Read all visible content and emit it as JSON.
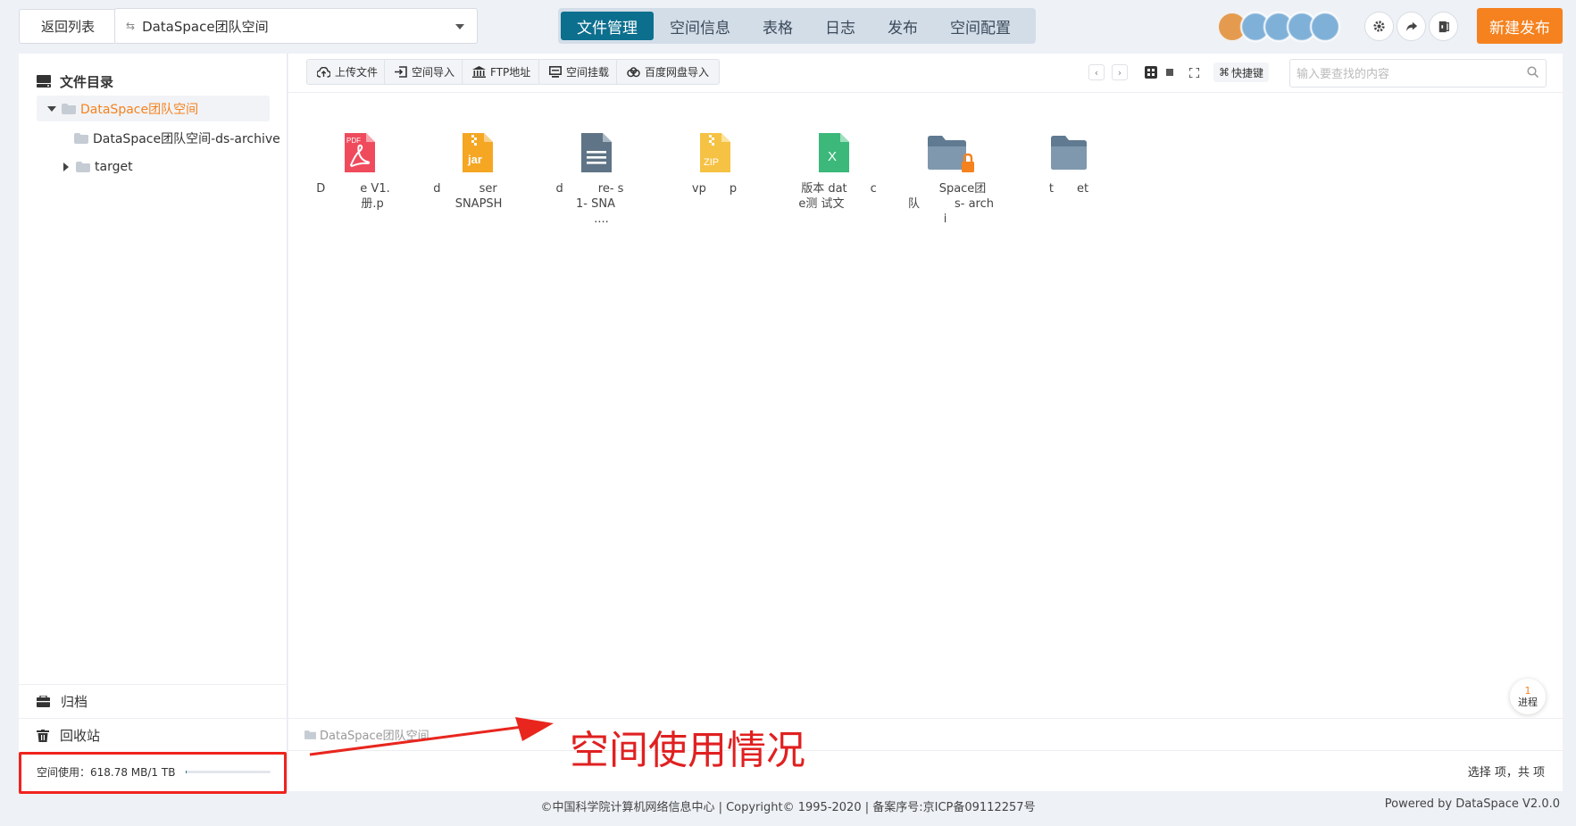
{
  "header": {
    "back_label": "返回列表",
    "space_name": "DataSpace团队空间",
    "tabs": [
      {
        "label": "文件管理"
      },
      {
        "label": "空间信息"
      },
      {
        "label": "表格"
      },
      {
        "label": "日志"
      },
      {
        "label": "发布"
      },
      {
        "label": "空间配置"
      }
    ],
    "new_publish_label": "新建发布",
    "accent_color": "#f5821f",
    "active_tab_color": "#0d6f8e"
  },
  "sidebar": {
    "title": "文件目录",
    "tree": {
      "root": "DataSpace团队空间",
      "children": [
        "DataSpace团队空间-ds-archive",
        "target"
      ]
    },
    "archive_label": "归档",
    "recycle_label": "回收站",
    "usage_text": "空间使用：618.78 MB/1 TB",
    "usage_fraction": 0.0006
  },
  "toolbar": {
    "upload": "上传文件",
    "space_import": "空间导入",
    "ftp": "FTP地址",
    "mount": "空间挂载",
    "baidu_import": "百度网盘导入",
    "shortcut": "快捷键",
    "search_placeholder": "输入要查找的内容"
  },
  "files": [
    {
      "type": "pdf",
      "badge": "PDF",
      "name": "D   e V1.     册.p "
    },
    {
      "type": "jar",
      "badge": "jar",
      "name": "d    ser    SNAPSH "
    },
    {
      "type": "doc",
      "badge": "",
      "name": "d   re- s   1- SNA   ...."
    },
    {
      "type": "zip",
      "badge": "ZIP",
      "name": "vp  p"
    },
    {
      "type": "xls",
      "badge": "X",
      "name": " 版本 dat  ce测 试文  "
    },
    {
      "type": "folder-locked",
      "badge": "",
      "name": "  Space团 队   s- archi "
    },
    {
      "type": "folder",
      "badge": "",
      "name": "t  et"
    }
  ],
  "progress": {
    "count": "1",
    "label": "进程"
  },
  "path": "DataSpace团队空间",
  "status": "选择 项，共 项",
  "annotation": "空间使用情况",
  "footer": {
    "copyright": "©中国科学院计算机网络信息中心  |  Copyright© 1995-2020  |  备案序号:京ICP备09112257号",
    "powered": "Powered by DataSpace V2.0.0"
  }
}
